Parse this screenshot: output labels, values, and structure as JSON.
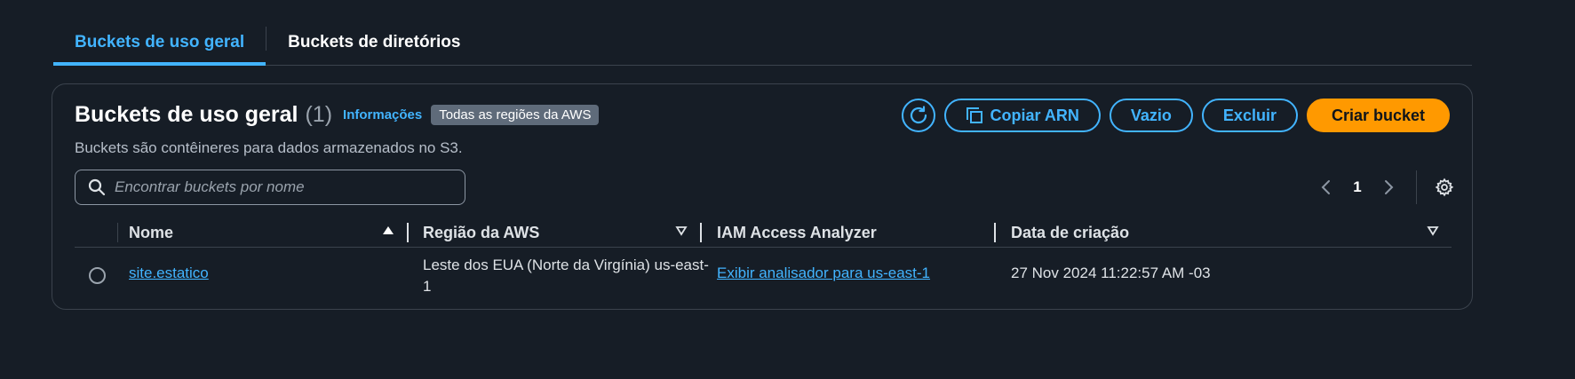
{
  "tabs": [
    {
      "label": "Buckets de uso geral",
      "active": true
    },
    {
      "label": "Buckets de diretórios",
      "active": false
    }
  ],
  "header": {
    "title": "Buckets de uso geral",
    "count": "(1)",
    "info_link": "Informações",
    "region_badge": "Todas as regiões da AWS",
    "subtitle": "Buckets são contêineres para dados armazenados no S3."
  },
  "actions": {
    "refresh_icon": "refresh-icon",
    "copy_arn": "Copiar ARN",
    "copy_icon": "copy-icon",
    "empty": "Vazio",
    "delete": "Excluir",
    "create": "Criar bucket"
  },
  "search": {
    "placeholder": "Encontrar buckets por nome",
    "value": ""
  },
  "pagination": {
    "current_page": "1"
  },
  "table": {
    "columns": [
      {
        "label": "Nome",
        "sort": "ascending"
      },
      {
        "label": "Região da AWS",
        "sort": "none"
      },
      {
        "label": "IAM Access Analyzer",
        "sort": ""
      },
      {
        "label": "Data de criação",
        "sort": "none"
      }
    ],
    "rows": [
      {
        "name": "site.estatico",
        "region_line1": "Leste dos EUA (Norte da Virgínia) us-east-",
        "region_line2": "1",
        "analyzer": "Exibir analisador para us-east-1",
        "created": "27 Nov 2024 11:22:57 AM -03"
      }
    ]
  },
  "colors": {
    "background": "#161d26",
    "accent": "#42b4ff",
    "primary_button": "#ff9900",
    "border": "#3b434d"
  }
}
